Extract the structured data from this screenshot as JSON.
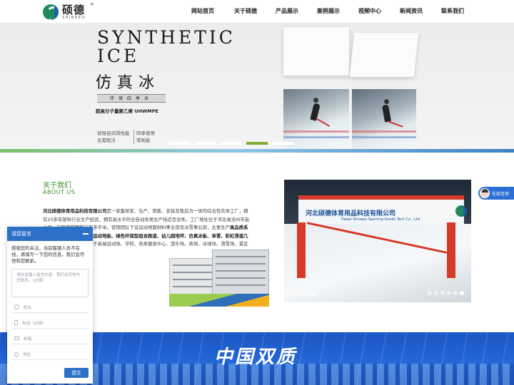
{
  "header": {
    "logo_cn": "硕德",
    "logo_en": "SHINEEO",
    "logo_reg": "®",
    "nav": [
      "网站首页",
      "关于硕德",
      "产品展示",
      "案例展示",
      "视频中心",
      "新闻资讯",
      "联系我们"
    ]
  },
  "banner": {
    "title_en_1": "SYNTHETIC",
    "title_en_2": "ICE",
    "title_cn": "仿真冰",
    "badge": "环保四季冰",
    "subtitle": "超高分子量聚乙烯 UHWMPE",
    "features": [
      [
        "韧强自润滑性能",
        "四季使用"
      ],
      [
        "无需制冷",
        "零耗能"
      ]
    ],
    "slide_count": 5,
    "active_slide": 4
  },
  "about": {
    "title": "关于我们",
    "subtitle": "ABOUT US",
    "company": "河北硕德体育用品科技有限公司",
    "text_1": "是一家集研发、生产、销售、安装及售后为一体的综合性实体工厂，拥有20多年塑料行业生产经验，拥有高水平的全自动各类生产线近百余条。工厂地址位于河北省沧州市盐山县，厂房建筑面积二万多平米。营销团队下设运动地面材料事业部及冰雪事业部，主要生产",
    "highlight": "高品质系列高端运动地板、悬浮式运动地板、绿色环保型组合跑道、幼儿园地坪、仿真冰板、旱雪、彩虹滑道几大系列产品",
    "text_2": "，被广泛应用于高端运动场、学校、各类健身中心、游乐场、商场、冰球场、滑雪场、景区等场所。"
  },
  "expo": {
    "brand_cn": "河北硕德体育用品科技有限公司",
    "brand_en": "Hebei Shineeo Sporting Goods Tech Co., Ltd",
    "caption": "2018体博会",
    "slide_count": 6,
    "active_slide": 6
  },
  "band": {
    "title": "中国双质"
  },
  "consult": {
    "label": "在线咨询"
  },
  "chat": {
    "title": "请您留言",
    "intro": "感谢您的关注，当前客服人员不在线，请填写一下您的信息，我们会尽快和您联系。",
    "message_placeholder": "请在此输入留言内容，我们会尽快与您联系。（必填）",
    "name_placeholder": "姓名",
    "phone_placeholder": "电话（必填）",
    "email_placeholder": "邮箱",
    "address_placeholder": "地址",
    "submit": "提交"
  }
}
